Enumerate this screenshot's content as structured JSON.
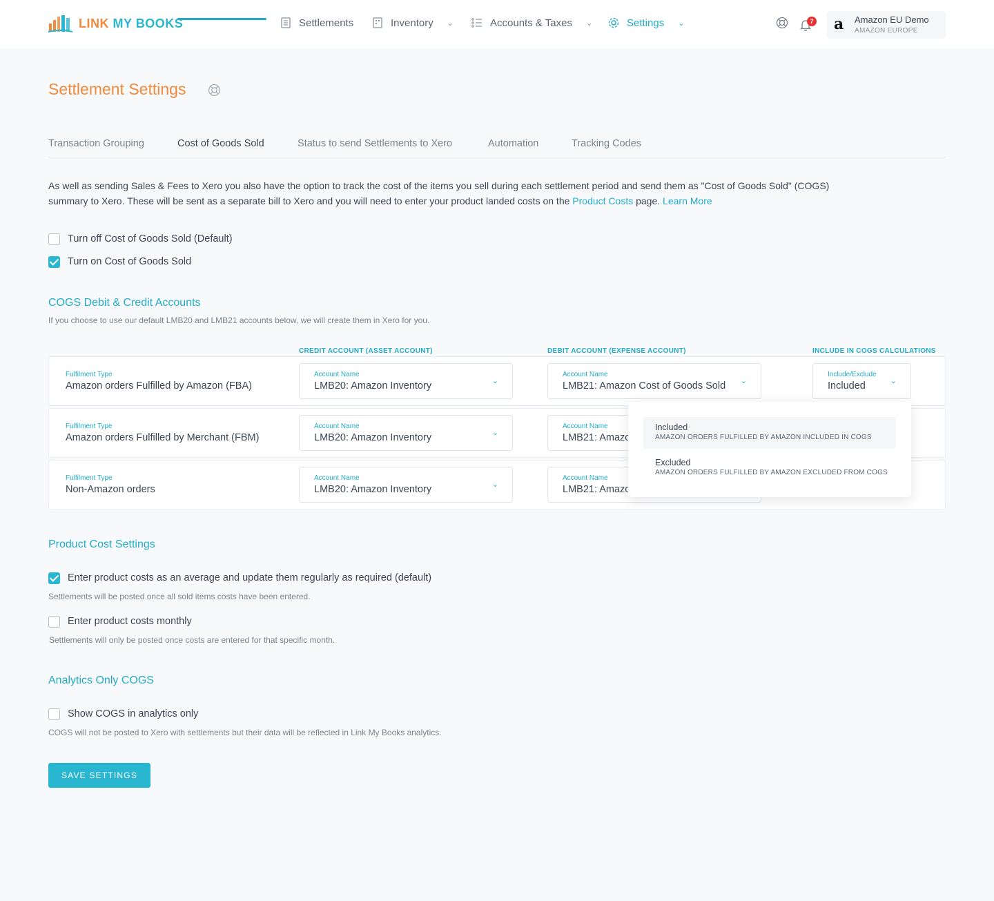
{
  "brand": {
    "logo_text_1": "LINK",
    "logo_text_2": "MY BOOKS"
  },
  "nav": {
    "settlements": "Settlements",
    "inventory": "Inventory",
    "accounts_taxes": "Accounts & Taxes",
    "settings": "Settings"
  },
  "notifications": {
    "count": "7"
  },
  "account": {
    "logo": "a",
    "name": "Amazon EU Demo",
    "region": "AMAZON EUROPE"
  },
  "page": {
    "title": "Settlement Settings"
  },
  "tabs": [
    {
      "label": "Transaction Grouping"
    },
    {
      "label": "Cost of Goods Sold"
    },
    {
      "label": "Status to send Settlements to Xero"
    },
    {
      "label": "Automation"
    },
    {
      "label": "Tracking Codes"
    }
  ],
  "intro": {
    "text_1": "As well as sending Sales & Fees to Xero you also have the option to track the cost of the items you sell during each settlement period and send them as \"Cost of Goods Sold\" (COGS) summary to Xero. These will be sent as a separate bill to Xero and you will need to enter your product landed costs on the",
    "link_1": "Product Costs",
    "text_2": "page.",
    "link_2": "Learn More"
  },
  "cogs_toggle": {
    "off_label": "Turn off Cost of Goods Sold (Default)",
    "off_checked": false,
    "on_label": "Turn on Cost of Goods Sold",
    "on_checked": true
  },
  "accounts_section": {
    "title": "COGS Debit & Credit Accounts",
    "subtitle": "If you choose to use our default LMB20 and LMB21 accounts below, we will create them in Xero for you.",
    "col_credit": "CREDIT ACCOUNT (ASSET ACCOUNT)",
    "col_debit": "DEBIT ACCOUNT (EXPENSE ACCOUNT)",
    "col_include": "INCLUDE IN COGS CALCULATIONS",
    "rows": [
      {
        "type_label": "Fulfilment Type",
        "type": "Amazon orders Fulfilled by Amazon (FBA)",
        "credit_label": "Account Name",
        "credit": "LMB20: Amazon Inventory",
        "debit_label": "Account Name",
        "debit": "LMB21: Amazon Cost of Goods Sold",
        "include_label": "Include/Exclude",
        "include": "Included"
      },
      {
        "type_label": "Fulfilment Type",
        "type": "Amazon orders Fulfilled by Merchant (FBM)",
        "credit_label": "Account Name",
        "credit": "LMB20: Amazon Inventory",
        "debit_label": "Account Name",
        "debit": "LMB21: Amazon Cost of Goods Sold"
      },
      {
        "type_label": "Fulfilment Type",
        "type": "Non-Amazon orders",
        "credit_label": "Account Name",
        "credit": "LMB20: Amazon Inventory",
        "debit_label": "Account Name",
        "debit": "LMB21: Amazon Cost of Goods Sold"
      }
    ],
    "dropdown": [
      {
        "title": "Included",
        "desc": "AMAZON ORDERS FULFILLED BY AMAZON INCLUDED IN COGS",
        "selected": true
      },
      {
        "title": "Excluded",
        "desc": "AMAZON ORDERS FULFILLED BY AMAZON EXCLUDED FROM COGS",
        "selected": false
      }
    ]
  },
  "product_cost": {
    "title": "Product Cost Settings",
    "avg_label": "Enter product costs as an average and update them regularly as required (default)",
    "avg_checked": true,
    "avg_hint": "Settlements will be posted once all sold items costs have been entered.",
    "monthly_label": "Enter product costs monthly",
    "monthly_checked": false,
    "monthly_hint": "Settlements will only be posted once costs are entered for that specific month."
  },
  "analytics": {
    "title": "Analytics Only COGS",
    "label": "Show COGS in analytics only",
    "checked": false,
    "hint": "COGS will not be posted to Xero with settlements but their data will be reflected in Link My Books analytics."
  },
  "save_label": "SAVE SETTINGS",
  "colors": {
    "accent": "#29b6d1",
    "brand_orange": "#f08a3c",
    "badge": "#e63232"
  }
}
